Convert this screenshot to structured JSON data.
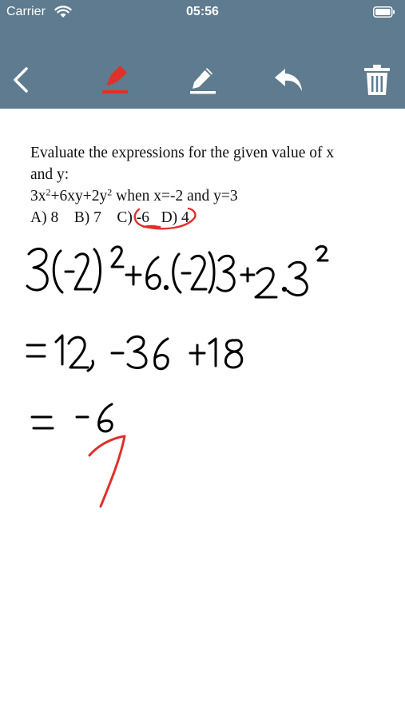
{
  "status_bar": {
    "carrier": "Carrier",
    "time": "05:56",
    "icons": [
      "wifi-icon",
      "battery-icon"
    ]
  },
  "toolbar": {
    "icons": [
      "back-icon",
      "highlighter-icon",
      "pen-icon",
      "undo-icon",
      "trash-icon"
    ],
    "active_tool_color": "#e0302a",
    "background_color": "#5e7b8f"
  },
  "question": {
    "line1": "Evaluate the expressions for the given value of x",
    "line2": "and y:",
    "expr": {
      "t1": "3x",
      "exp1": "2",
      "t2": "+6xy+2y",
      "exp2": "2",
      "t3": " when x=-2 and y=3"
    },
    "options": {
      "a": "A) 8",
      "b": "B) 7",
      "c": "C) -6",
      "d": "D) 4"
    }
  },
  "handwriting": {
    "ink_color": "#000000",
    "mark_color": "#e0302a"
  }
}
